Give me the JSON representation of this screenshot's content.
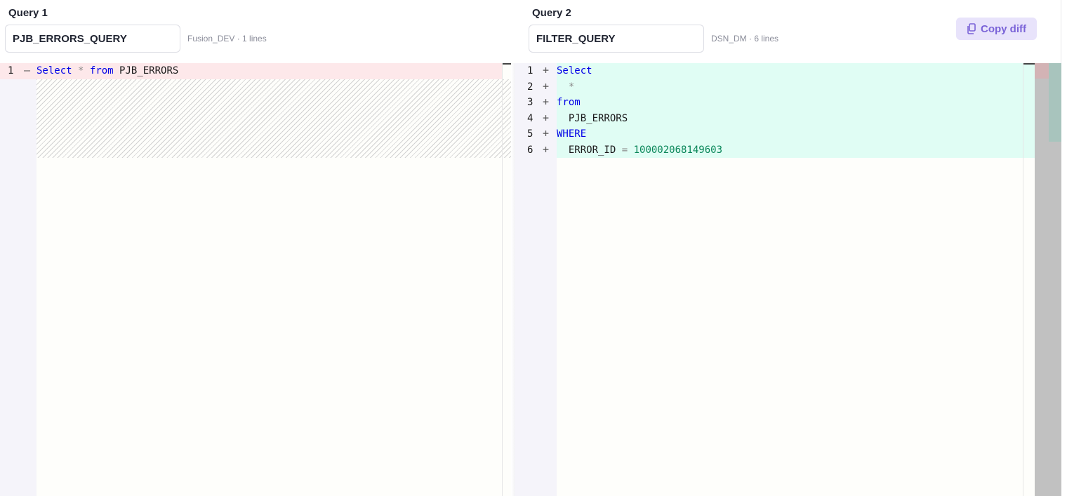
{
  "left": {
    "label": "Query 1",
    "query_name": "PJB_ERRORS_QUERY",
    "meta": "Fusion_DEV · 1 lines",
    "lines": [
      {
        "num": "1",
        "sign": "—",
        "tokens": [
          {
            "t": "Select",
            "c": "kw"
          },
          {
            "t": " ",
            "c": "plain"
          },
          {
            "t": "*",
            "c": "op"
          },
          {
            "t": " ",
            "c": "plain"
          },
          {
            "t": "from",
            "c": "kw"
          },
          {
            "t": " PJB_ERRORS",
            "c": "plain"
          }
        ]
      }
    ]
  },
  "right": {
    "label": "Query 2",
    "query_name": "FILTER_QUERY",
    "meta": "DSN_DM · 6 lines",
    "lines": [
      {
        "num": "1",
        "sign": "+",
        "tokens": [
          {
            "t": "Select",
            "c": "kw"
          }
        ]
      },
      {
        "num": "2",
        "sign": "+",
        "tokens": [
          {
            "t": "  ",
            "c": "plain"
          },
          {
            "t": "*",
            "c": "op"
          }
        ]
      },
      {
        "num": "3",
        "sign": "+",
        "tokens": [
          {
            "t": "from",
            "c": "kw"
          }
        ]
      },
      {
        "num": "4",
        "sign": "+",
        "tokens": [
          {
            "t": "  PJB_ERRORS",
            "c": "plain"
          }
        ]
      },
      {
        "num": "5",
        "sign": "+",
        "tokens": [
          {
            "t": "WHERE",
            "c": "kw"
          }
        ]
      },
      {
        "num": "6",
        "sign": "+",
        "tokens": [
          {
            "t": "  ERROR_ID ",
            "c": "plain"
          },
          {
            "t": "=",
            "c": "op"
          },
          {
            "t": " ",
            "c": "plain"
          },
          {
            "t": "100002068149603",
            "c": "numlit"
          }
        ]
      }
    ]
  },
  "toolbar": {
    "copy_label": "Copy diff",
    "copy_icon": "copy-icon"
  },
  "colors": {
    "removed_bg": "#fde8ea",
    "added_bg": "#e0fdf4",
    "keyword": "#0000e6",
    "number": "#098658",
    "accent": "#7a63d8"
  }
}
